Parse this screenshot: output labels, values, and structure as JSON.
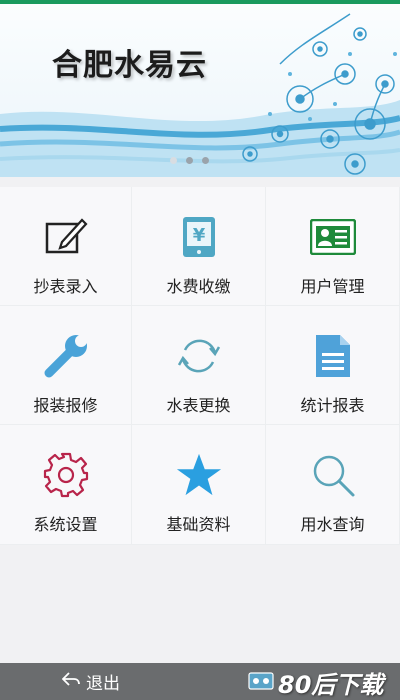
{
  "banner": {
    "title": "合肥水易云",
    "dots": 3
  },
  "menu": [
    {
      "label": "抄表录入",
      "icon": "edit-icon"
    },
    {
      "label": "水费收缴",
      "icon": "yuan-payment-icon"
    },
    {
      "label": "用户管理",
      "icon": "user-card-icon"
    },
    {
      "label": "报装报修",
      "icon": "wrench-icon"
    },
    {
      "label": "水表更换",
      "icon": "refresh-icon"
    },
    {
      "label": "统计报表",
      "icon": "document-icon"
    },
    {
      "label": "系统设置",
      "icon": "gear-icon"
    },
    {
      "label": "基础资料",
      "icon": "star-icon"
    },
    {
      "label": "用水查询",
      "icon": "search-icon"
    }
  ],
  "footer": {
    "exit_label": "退出"
  },
  "watermark": {
    "text": "80后下载"
  },
  "colors": {
    "accent": "#1a9a5e",
    "teal": "#4fa7c4",
    "blue": "#3aa0d8",
    "green": "#1e8a3a",
    "red": "#b8244a"
  }
}
